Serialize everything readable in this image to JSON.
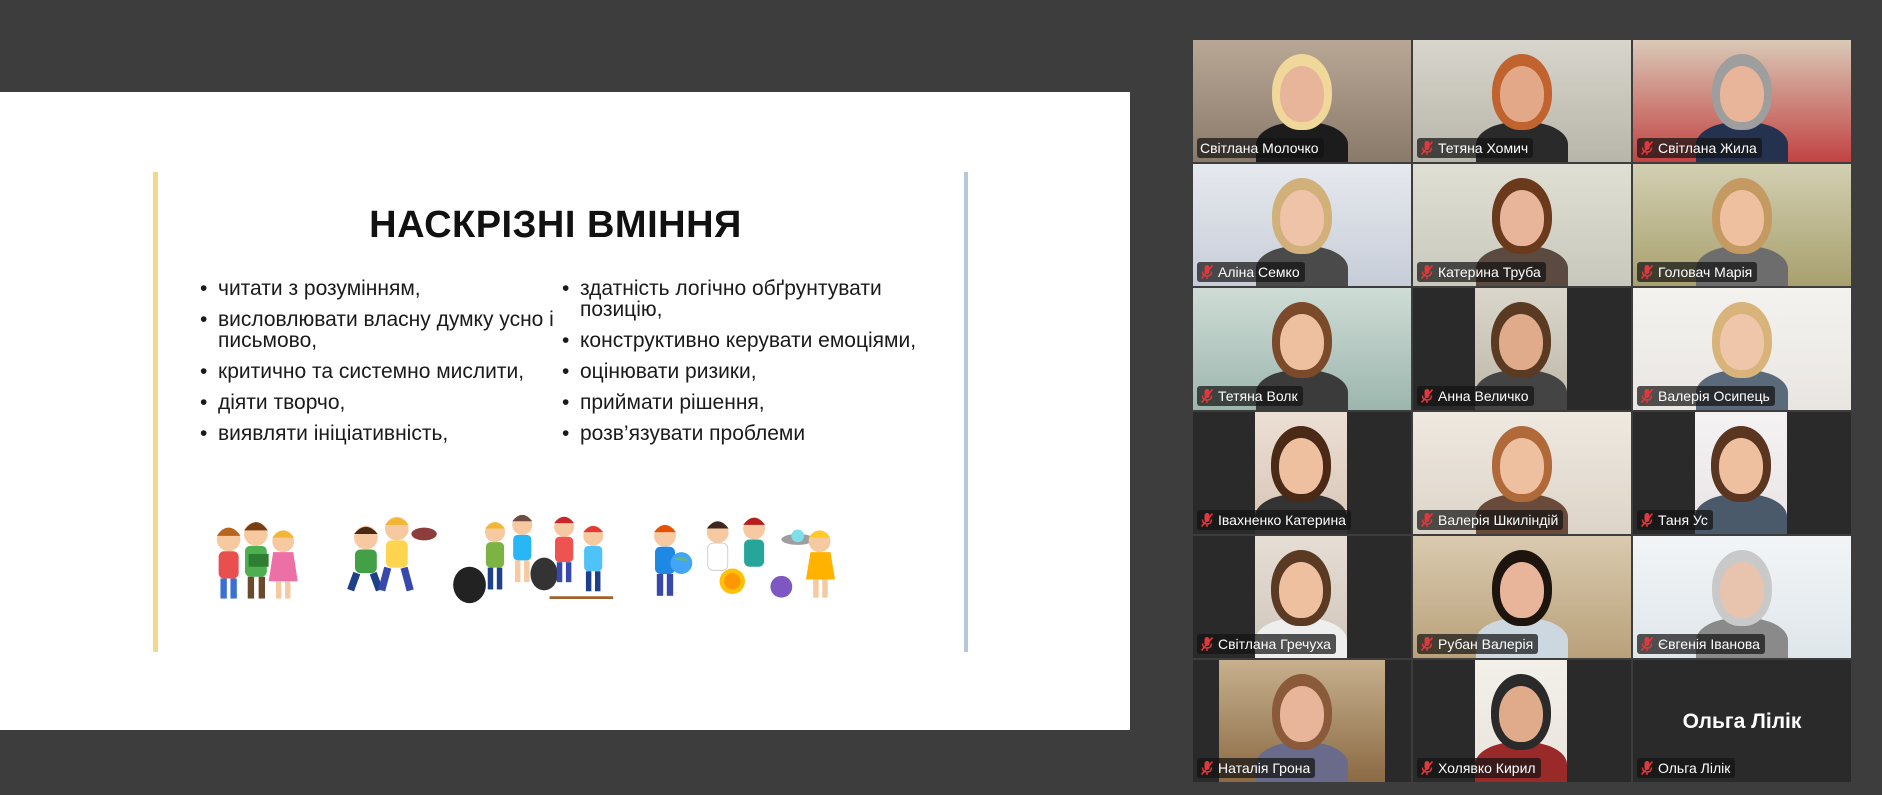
{
  "slide": {
    "title": "НАСКРІЗНІ ВМІННЯ",
    "left_bullets": [
      "читати з розумінням,",
      "висловлювати власну думку усно і письмово,",
      "критично та системно мислити,",
      "діяти творчо,",
      "виявляти ініціативність,"
    ],
    "right_bullets": [
      "здатність логічно обґрунтувати позицію,",
      "конструктивно керувати емоціями,",
      "оцінювати ризики,",
      "приймати рішення,",
      "розв’язувати проблеми"
    ]
  },
  "gallery": {
    "active_color": "#23d96e",
    "mic_muted_color": "#e0383b",
    "participants": [
      {
        "name": "Світлана Молочко",
        "muted": false,
        "active": true
      },
      {
        "name": "Тетяна Хомич",
        "muted": true
      },
      {
        "name": "Світлана Жила",
        "muted": true
      },
      {
        "name": "Аліна Семко",
        "muted": true
      },
      {
        "name": "Катерина Труба",
        "muted": true
      },
      {
        "name": "Головач Марія",
        "muted": true
      },
      {
        "name": "Тетяна Волк",
        "muted": true
      },
      {
        "name": "Анна Величко",
        "muted": true
      },
      {
        "name": "Валерія Осипець",
        "muted": true
      },
      {
        "name": "Івахненко Катерина",
        "muted": true
      },
      {
        "name": "Валерія Шкиліндій",
        "muted": true
      },
      {
        "name": "Таня Ус",
        "muted": true
      },
      {
        "name": "Світлана Гречуха",
        "muted": true
      },
      {
        "name": "Рубан Валерія",
        "muted": true
      },
      {
        "name": "Євгенія Іванова",
        "muted": true
      },
      {
        "name": "Наталія Грона",
        "muted": true
      },
      {
        "name": "Холявко Кирил",
        "muted": true
      },
      {
        "name": "Ольга Лілік",
        "muted": true,
        "video_off": true,
        "display_name": "Ольга Лілік"
      }
    ]
  }
}
